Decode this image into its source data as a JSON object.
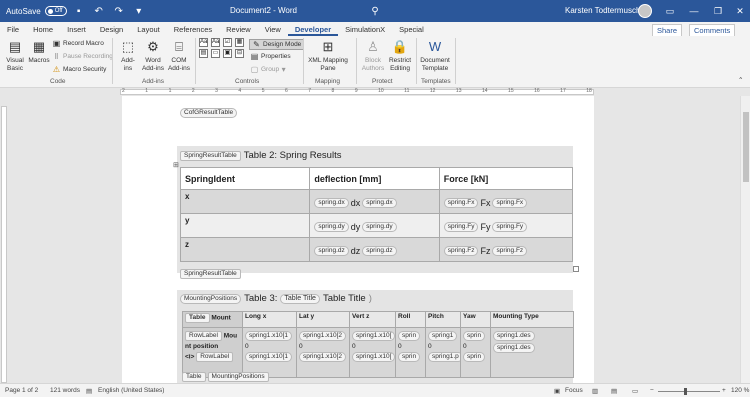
{
  "titlebar": {
    "autosave_label": "AutoSave",
    "autosave_state": "Off",
    "document_title": "Document2 - Word",
    "user_name": "Karsten Todtermuschke",
    "icons": [
      "save-icon",
      "undo-icon",
      "redo-icon",
      "customize-icon",
      "search-icon",
      "minimize-icon",
      "restore-icon",
      "close-icon"
    ]
  },
  "tabs": [
    "File",
    "Home",
    "Insert",
    "Design",
    "Layout",
    "References",
    "Review",
    "View",
    "Developer",
    "SimulationX",
    "Special"
  ],
  "active_tab": "Developer",
  "share_label": "Share",
  "comments_label": "Comments",
  "ribbon": {
    "code": {
      "visual_basic": "Visual Basic",
      "macros": "Macros",
      "record_macro": "Record Macro",
      "pause_recording": "Pause Recording",
      "macro_security": "Macro Security",
      "group_label": "Code"
    },
    "addins": {
      "addins": "Add-ins",
      "word_addins": "Word Add-ins",
      "com_addins": "COM Add-ins",
      "group_label": "Add-ins"
    },
    "controls": {
      "design_mode": "Design Mode",
      "properties": "Properties",
      "group": "Group",
      "glyphs": [
        "Aa",
        "Aa",
        "☑",
        "▦",
        "▤",
        "▭",
        "▣",
        "⊟"
      ],
      "group_label": "Controls"
    },
    "mapping": {
      "xml_mapping_pane": "XML Mapping Pane",
      "group_label": "Mapping"
    },
    "protect": {
      "block_authors": "Block Authors",
      "restrict_editing": "Restrict Editing",
      "group_label": "Protect"
    },
    "templates": {
      "document_template": "Document Template",
      "group_label": "Templates"
    }
  },
  "ruler_numbers": [
    "2",
    "1",
    "1",
    "2",
    "3",
    "4",
    "5",
    "6",
    "7",
    "8",
    "9",
    "10",
    "11",
    "12",
    "13",
    "14",
    "15",
    "16",
    "17",
    "18"
  ],
  "document": {
    "cofg_tag": "CofGResultTable",
    "spring_caption_tag": "SpringResultTable",
    "spring_caption": "Table 2: Spring Results",
    "spring_headers": [
      "SpringIdent",
      "deflection [mm]",
      "Force [kN]"
    ],
    "spring_rows": [
      {
        "ident": "x",
        "defl_tag1": "spring.dx",
        "defl_sym": "dx",
        "defl_tag2": "spring.dx",
        "force_tag1": "spring.Fx",
        "force_sym": "Fx",
        "force_tag2": "spring.Fx"
      },
      {
        "ident": "y",
        "defl_tag1": "spring.dy",
        "defl_sym": "dy",
        "defl_tag2": "spring.dy",
        "force_tag1": "spring.Fy",
        "force_sym": "Fy",
        "force_tag2": "spring.Fy"
      },
      {
        "ident": "z",
        "defl_tag1": "spring.dz",
        "defl_sym": "dz",
        "defl_tag2": "spring.dz",
        "force_tag1": "spring.Fz",
        "force_sym": "Fz",
        "force_tag2": "spring.Fz"
      }
    ],
    "spring_end_tag": "SpringResultTable",
    "mounting_tag": "MountingPositions",
    "mounting_caption_prefix": "Table 3:",
    "table_title_tag": "Table Title",
    "table_title_text": "Table Title",
    "mount_headers": [
      "Mount",
      "Long x",
      "Lat y",
      "Vert z",
      "Roll",
      "Pitch",
      "Yaw",
      "Mounting Type"
    ],
    "mount_header_tag": "Table",
    "mount_body": {
      "rowlabel_tag": "RowLabel",
      "rowlabel_text_a": "Mou",
      "rowlabel_text_b": "nt position",
      "marker": "<i>",
      "rowlabel_tag2": "RowLabel",
      "long_tag1": "spring1.x10[1",
      "long_zero": "0",
      "long_tag2": "spring1.x10[1",
      "lat_tag1": "spring1.x10[2",
      "lat_zero": "0",
      "lat_tag2": "spring1.x10[2",
      "vert_tag1": "spring1.x10[",
      "vert_zero": "0",
      "vert_tag2": "spring1.x10[",
      "roll_tag1": "sprin",
      "roll_zero": "0",
      "roll_tag2": "sprin",
      "pitch_tag1": "spring1",
      "pitch_zero": "0",
      "pitch_tag2": "spring1.p",
      "yaw_tag1": "sprin",
      "yaw_zero": "0",
      "yaw_tag2": "sprin",
      "type_tag1": "spring1.des",
      "type_tag2": "spring1.des"
    },
    "bottom_tag1": "Table",
    "bottom_tag2": "MountingPositions"
  },
  "status": {
    "page": "Page 1 of 2",
    "words": "121 words",
    "language": "English (United States)",
    "focus": "Focus",
    "zoom": "120 %",
    "zoom_minus": "−",
    "zoom_plus": "+"
  }
}
